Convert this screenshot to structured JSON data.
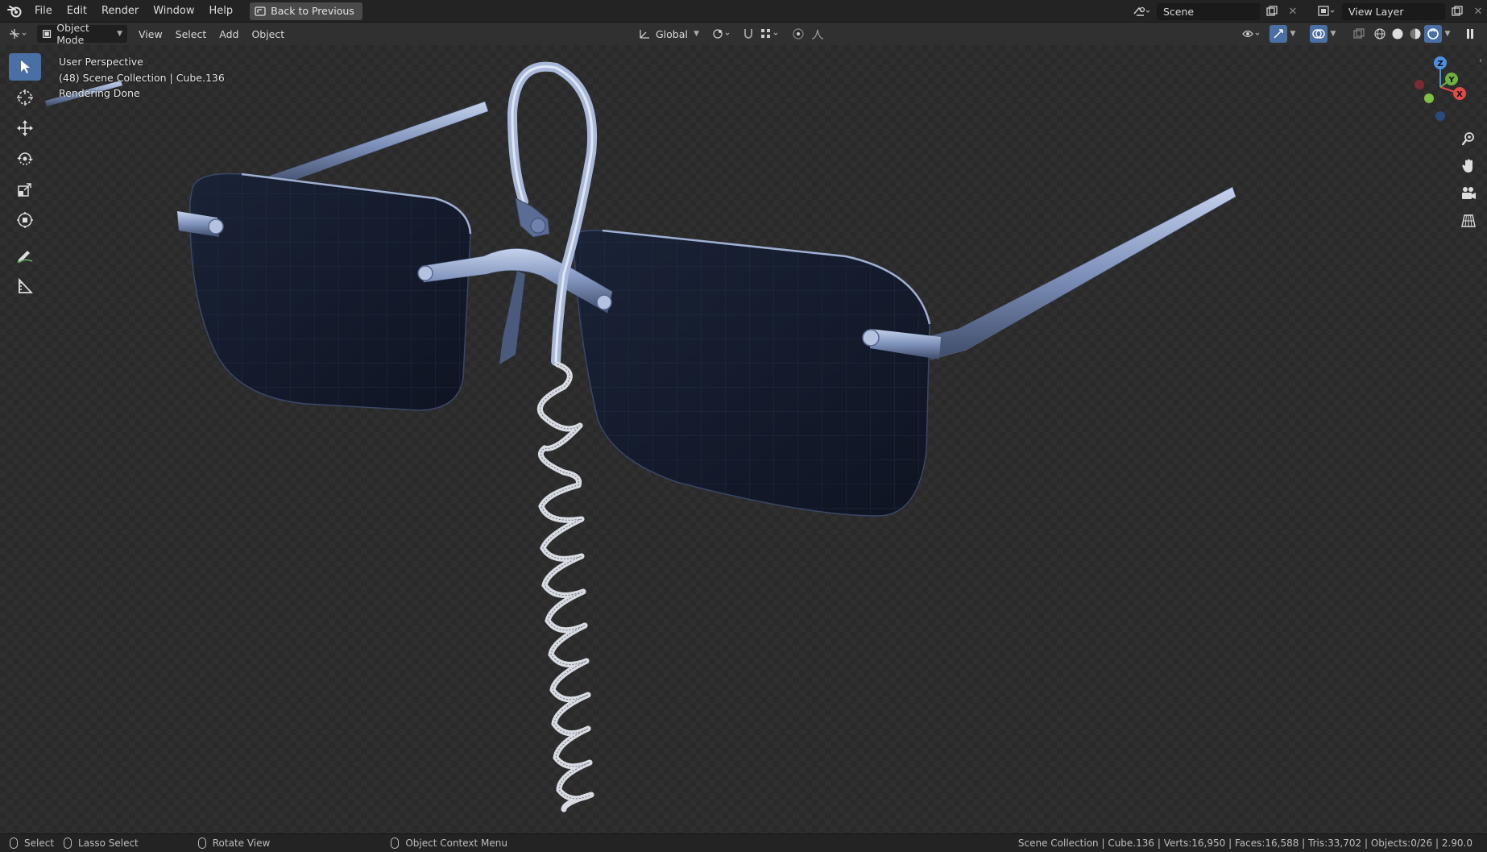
{
  "topbar": {
    "menus": [
      "File",
      "Edit",
      "Render",
      "Window",
      "Help"
    ],
    "back_label": "Back to Previous",
    "scene_label": "Scene",
    "view_layer_label": "View Layer"
  },
  "header": {
    "mode_label": "Object Mode",
    "menus": [
      "View",
      "Select",
      "Add",
      "Object"
    ],
    "orientation_label": "Global"
  },
  "viewport": {
    "overlay": {
      "line1": "User Perspective",
      "line2": "(48) Scene Collection | Cube.136",
      "line3": "Rendering Done"
    },
    "gizmo": {
      "z": "Z",
      "y": "Y",
      "x": "X"
    }
  },
  "toolbar": {
    "tools": [
      "select-box",
      "cursor",
      "move",
      "rotate",
      "scale",
      "transform",
      "annotate",
      "measure"
    ]
  },
  "statusbar": {
    "select": "Select",
    "lasso": "Lasso Select",
    "rotate": "Rotate View",
    "context": "Object Context Menu",
    "stats": "Scene Collection | Cube.136 | Verts:16,950 | Faces:16,588 | Tris:33,702 | Objects:0/26 | 2.90.0"
  },
  "colors": {
    "accent": "#4a6fa5",
    "lens": "#141b2a",
    "frame": "#8ea0c8",
    "spring": "#d8dce2"
  }
}
